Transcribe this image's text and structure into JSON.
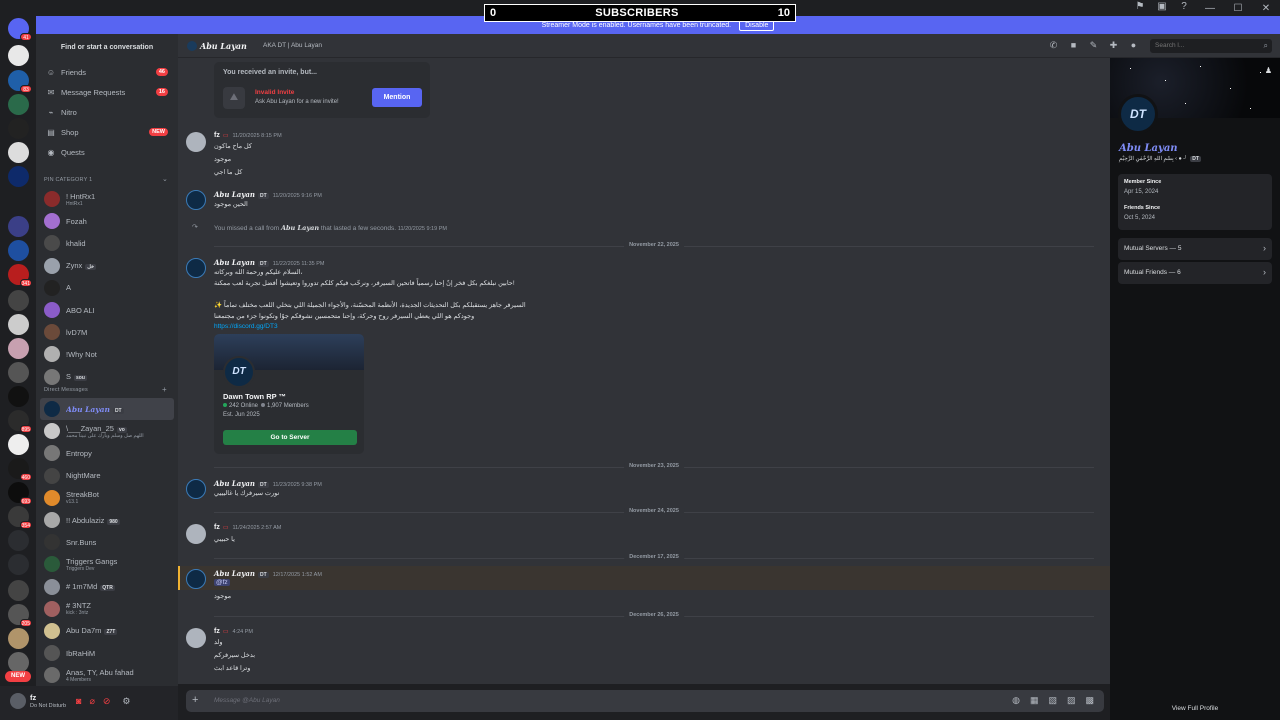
{
  "subscribers": {
    "min": "0",
    "title": "SUBSCRIBERS",
    "max": "10"
  },
  "streamer_banner": {
    "text": "Streamer Mode is enabled. Usernames have been truncated.",
    "disable_label": "Disable"
  },
  "rail_badges": [
    "41",
    "83",
    "341",
    "895",
    "460",
    "693",
    "354",
    "205"
  ],
  "rail_new_label": "NEW",
  "sidebar": {
    "find_label": "Find or start a conversation",
    "nav": [
      {
        "label": "Friends",
        "badge": "46",
        "icon": "friends-icon"
      },
      {
        "label": "Message Requests",
        "badge": "16",
        "icon": "mail-icon"
      },
      {
        "label": "Nitro",
        "badge": "",
        "icon": "nitro-icon"
      },
      {
        "label": "Shop",
        "badge": "NEW",
        "icon": "shop-icon"
      },
      {
        "label": "Quests",
        "badge": "",
        "icon": "quests-icon"
      }
    ],
    "pin_category": "PIN CATEGORY 1",
    "pinned": [
      {
        "name": "! HntRx1",
        "sub": "HntRx1"
      },
      {
        "name": "Fozah",
        "sub": ""
      },
      {
        "name": "khalid",
        "sub": ""
      },
      {
        "name": "Zynx",
        "sub": "",
        "tag": "خل"
      },
      {
        "name": "A",
        "sub": ""
      },
      {
        "name": "ABO ALI",
        "sub": ""
      },
      {
        "name": "lvD7M",
        "sub": ""
      },
      {
        "name": "!Why Not",
        "sub": ""
      },
      {
        "name": "S",
        "sub": "",
        "tag": "sou"
      }
    ],
    "dm_header": "Direct Messages",
    "dms": [
      {
        "name": "Abu Layan",
        "sub": "",
        "tag": "DT",
        "active": true
      },
      {
        "name": "\\___Zayan_25",
        "sub": "اللهم صل وسلم وبارك على نبينا محمد",
        "tag": "vo"
      },
      {
        "name": "Entropy",
        "sub": ""
      },
      {
        "name": "NightMare",
        "sub": ""
      },
      {
        "name": "StreakBot",
        "sub": "v13.1"
      },
      {
        "name": "!! Abdulaziz",
        "sub": "",
        "tag": "980"
      },
      {
        "name": "Snr.Buns",
        "sub": ""
      },
      {
        "name": "Triggers Gangs",
        "sub": "Triggers Dev"
      },
      {
        "name": "# 1m7Md",
        "sub": "",
        "tag": "QTR"
      },
      {
        "name": "# 3NTZ",
        "sub": "kick : 3ntz"
      },
      {
        "name": "Abu Da7m",
        "sub": "",
        "tag": "Z7T"
      },
      {
        "name": "IbRaHiM",
        "sub": ""
      },
      {
        "name": "Anas, TY, Abu fahad",
        "sub": "4 Members"
      }
    ]
  },
  "user_panel": {
    "name": "fz",
    "status": "Do Not Disturb"
  },
  "header": {
    "name": "Abu Layan",
    "aka": "AKA   DT | Abu Layan",
    "search_placeholder": "Search l..."
  },
  "chat": {
    "invite": {
      "title": "You received an invite, but...",
      "invalid": "Invalid Invite",
      "ask": "Ask Abu Layan for a new invite!",
      "button": "Mention"
    },
    "msg1": {
      "author": "fz",
      "ts": "11/20/2025 8:15 PM",
      "lines": [
        "كل ماح ماكون",
        "موجود",
        "كل ما اجي"
      ]
    },
    "msg2": {
      "author": "Abu Layan",
      "tag": "DT",
      "ts": "11/20/2025 9:16 PM",
      "lines": [
        "الحين موجود"
      ]
    },
    "missed_call": {
      "prefix": "You missed a call from",
      "name": "Abu Layan",
      "suffix": "that lasted a few seconds.",
      "ts": "11/20/2025 9:19 PM"
    },
    "date1": "November 22, 2025",
    "msg3": {
      "author": "Abu Layan",
      "tag": "DT",
      "ts": "11/22/2025 11:35 PM",
      "lines": [
        "السلام عليكم ورحمة الله وبركاته،",
        "حابين نبلغكم بكل فخر إنّ إحنا رسمياً فاتحين السيرفر، ونرحّب فيكم كلكم تدوروا وتعيشوا أفضل تجربة لعب ممكنة!",
        "✨ السيرفر جاهز يستقبلكم بكل التحديثات الجديدة، الأنظمة المحسّنة، والأجواء الجميلة اللي بتخلي اللعب مختلف تماماً",
        "وجودكم هو اللي يعطي السيرفر روح وحركة، وإحنا متحمسين نشوفكم جوّا وتكونوا جزء من مجتمعنا"
      ],
      "link": "https://discord.gg/DT3"
    },
    "server_card": {
      "icon_text": "DT",
      "name": "Dawn Town RP ™",
      "online": "242 Online",
      "members": "1,907 Members",
      "est": "Est. Jun 2025",
      "button": "Go to Server"
    },
    "date2": "November 23, 2025",
    "msg4": {
      "author": "Abu Layan",
      "tag": "DT",
      "ts": "11/23/2025 9:38 PM",
      "lines": [
        "نورت سيرفرك يا غاليييي"
      ]
    },
    "date3": "November 24, 2025",
    "msg5": {
      "author": "fz",
      "ts": "11/24/2025 2:57 AM",
      "lines": [
        "يا حبيبي"
      ]
    },
    "date4": "December 17, 2025",
    "msg6": {
      "author": "Abu Layan",
      "tag": "DT",
      "ts": "12/17/2025 1:52 AM",
      "mention": "@fz",
      "lines": [
        "موجود"
      ]
    },
    "date5": "December 26, 2025",
    "msg7": {
      "author": "fz",
      "ts": "4:24 PM",
      "lines": [
        "ولد",
        "بدخل سيرفركم",
        "وترا قاعد ابث"
      ]
    }
  },
  "composer": {
    "placeholder": "Message @Abu Layan"
  },
  "profile": {
    "avatar_text": "DT",
    "name": "Abu Layan",
    "handle": "بِسْمِ اللهِ الرَّحْمٰنِ الرَّحِيْمِ ‹ ● ┘",
    "handle_tag": "DT",
    "member_since_label": "Member Since",
    "member_since": "Apr 15, 2024",
    "friends_since_label": "Friends Since",
    "friends_since": "Oct 5, 2024",
    "mutual_servers": "Mutual Servers — 5",
    "mutual_friends": "Mutual Friends — 6",
    "footer": "View Full Profile"
  },
  "colors": {
    "accent": "#5865f2",
    "danger": "#f23f43",
    "green": "#248046",
    "link": "#00a8fc",
    "name_blue": "#7f8cf6"
  }
}
